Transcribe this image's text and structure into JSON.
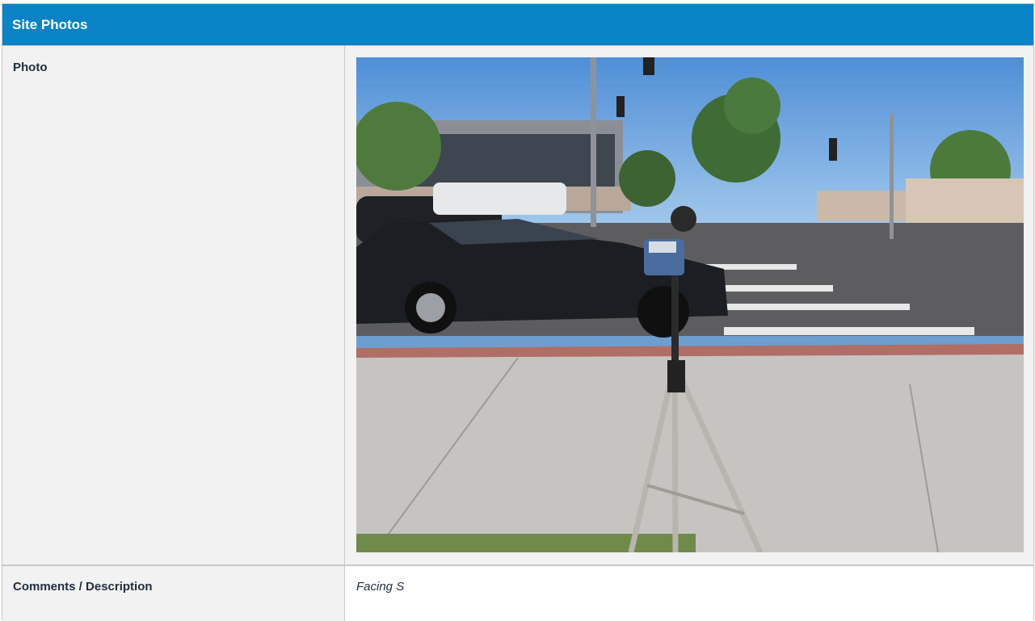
{
  "panel": {
    "title": "Site Photos"
  },
  "rows": {
    "photo": {
      "label": "Photo",
      "image_icon": "site-photo-image"
    },
    "comments": {
      "label": "Comments / Description",
      "value": "Facing S"
    }
  },
  "colors": {
    "header_bg": "#0a82c6",
    "label_bg": "#f2f2f2",
    "text": "#1f2d3d"
  }
}
